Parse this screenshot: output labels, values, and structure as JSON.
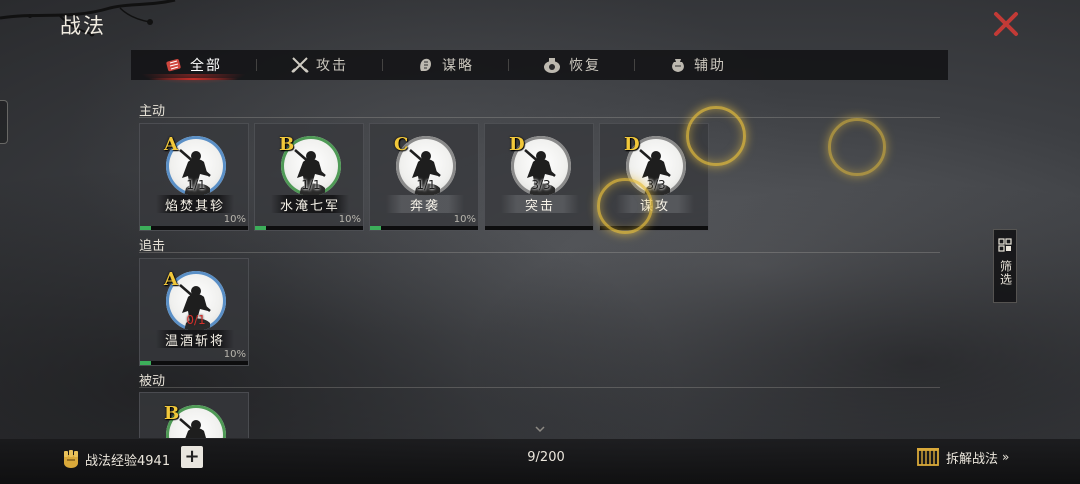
{
  "header": {
    "title": "战法"
  },
  "tabs": [
    {
      "label": "全部",
      "icon": "all-skills-icon",
      "active": true
    },
    {
      "label": "攻击",
      "icon": "crossed-swords-icon",
      "active": false
    },
    {
      "label": "谋略",
      "icon": "scroll-hand-icon",
      "active": false
    },
    {
      "label": "恢复",
      "icon": "potion-icon",
      "active": false
    },
    {
      "label": "辅助",
      "icon": "pouch-icon",
      "active": false
    }
  ],
  "sections": {
    "active": {
      "label": "主动",
      "cards": [
        {
          "grade": "A",
          "count": "1/1",
          "name": "焰焚其轸",
          "percent": "10%",
          "progress": 0.1,
          "ring": "blue",
          "count_color": "dark"
        },
        {
          "grade": "B",
          "count": "1/1",
          "name": "水淹七军",
          "percent": "10%",
          "progress": 0.1,
          "ring": "green",
          "count_color": "dark"
        },
        {
          "grade": "C",
          "count": "1/1",
          "name": "奔袭",
          "percent": "10%",
          "progress": 0.1,
          "ring": "gray",
          "count_color": "dark"
        },
        {
          "grade": "D",
          "count": "3/3",
          "name": "突击",
          "percent": "",
          "progress": 0,
          "ring": "gray",
          "count_color": "dark"
        },
        {
          "grade": "D",
          "count": "3/3",
          "name": "谋攻",
          "percent": "",
          "progress": 0,
          "ring": "gray",
          "count_color": "dark"
        }
      ]
    },
    "pursuit": {
      "label": "追击",
      "cards": [
        {
          "grade": "A",
          "count": "0/1",
          "name": "温酒斩将",
          "percent": "10%",
          "progress": 0.1,
          "ring": "blue",
          "count_color": "red"
        }
      ]
    },
    "passive": {
      "label": "被动",
      "cards": [
        {
          "grade": "B",
          "ring": "green"
        }
      ]
    }
  },
  "filter": {
    "label": "筛选"
  },
  "footer": {
    "exp_text": "战法经验4941",
    "plus_label": "+",
    "page_count": "9/200",
    "dismantle_label": "拆解战法",
    "dismantle_chevron": "»"
  },
  "colors": {
    "accent_red": "#c42e28",
    "grade_gold": "#f2c83a",
    "progress_green": "#3cae5a",
    "ring_blue": "#5a8fc6",
    "ring_green": "#4f9a56",
    "ring_gray": "#8a8a8a"
  }
}
